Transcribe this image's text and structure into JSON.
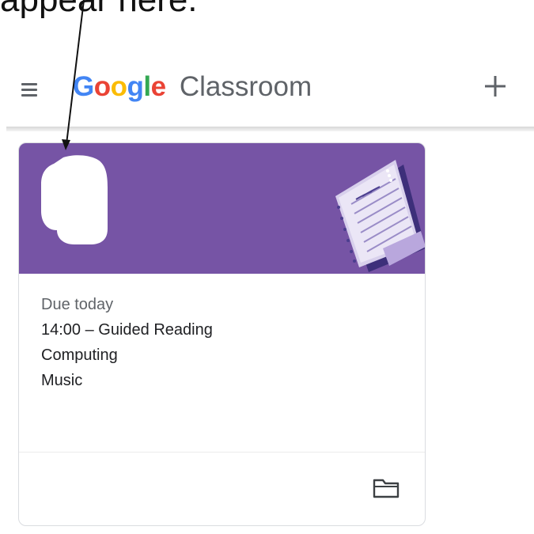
{
  "annotation": {
    "text": "appear here."
  },
  "header": {
    "menu_icon": "hamburger-menu-icon",
    "logo": {
      "letters": [
        {
          "char": "G",
          "color": "#4285F4"
        },
        {
          "char": "o",
          "color": "#EA4335"
        },
        {
          "char": "o",
          "color": "#FBBC05"
        },
        {
          "char": "g",
          "color": "#4285F4"
        },
        {
          "char": "l",
          "color": "#34A853"
        },
        {
          "char": "e",
          "color": "#EA4335"
        }
      ],
      "product": "Classroom"
    },
    "add_icon": "plus-icon"
  },
  "card": {
    "header_color": "#7654A5",
    "due_label": "Due today",
    "items": [
      "14:00 – Guided Reading",
      "Computing",
      "Music"
    ],
    "footer_icon": "folder-icon"
  }
}
